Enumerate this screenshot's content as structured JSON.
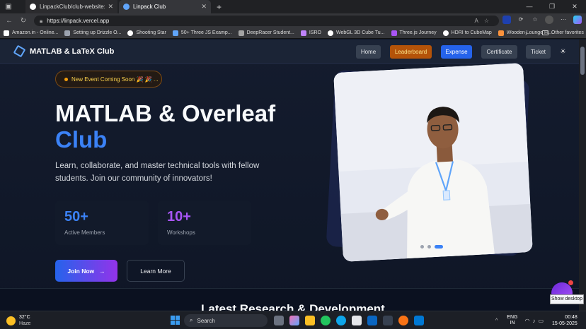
{
  "browser": {
    "tabs": [
      {
        "title": "LinpackClub/club-website: Fancy",
        "active": false
      },
      {
        "title": "Linpack Club",
        "active": true
      }
    ],
    "url": "https://linpack.vercel.app",
    "bookmarks": [
      "Amazon.in - Online...",
      "Setting up Drizzle O...",
      "Shooting Star",
      "50+ Three JS Examp...",
      "DeepRacer Student...",
      "ISRO",
      "WebGL 3D Cube Tu...",
      "Three.js Journey",
      "HDRI to CubeMap",
      "Wooden Lounge H..."
    ],
    "other_favorites": "Other favorites"
  },
  "site": {
    "brand": "MATLAB & LaTeX Club",
    "nav": {
      "home": "Home",
      "leaderboard": "Leaderboard",
      "expense": "Expense",
      "certificate": "Certificate",
      "ticket": "Ticket"
    },
    "badge": "New Event Coming Soon 🎉 🎉 ...",
    "hero": {
      "title_line1": "MATLAB & Overleaf",
      "title_accent": "Club",
      "description": "Learn, collaborate, and master technical tools with fellow students. Join our community of innovators!"
    },
    "stats": [
      {
        "value": "50+",
        "label": "Active Members"
      },
      {
        "value": "10+",
        "label": "Workshops"
      }
    ],
    "buttons": {
      "join": "Join Now",
      "learn": "Learn More"
    },
    "next_section_title": "Latest Research & Development",
    "tooltip": "Show desktop"
  },
  "taskbar": {
    "weather_temp": "32°C",
    "weather_cond": "Haze",
    "search": "Search",
    "lang_top": "ENG",
    "lang_bottom": "IN",
    "time": "00:48",
    "date": "15-05-2025"
  },
  "colors": {
    "accent": "#3b82f6",
    "purple": "#a855f7",
    "leaderboard": "#b45309"
  }
}
